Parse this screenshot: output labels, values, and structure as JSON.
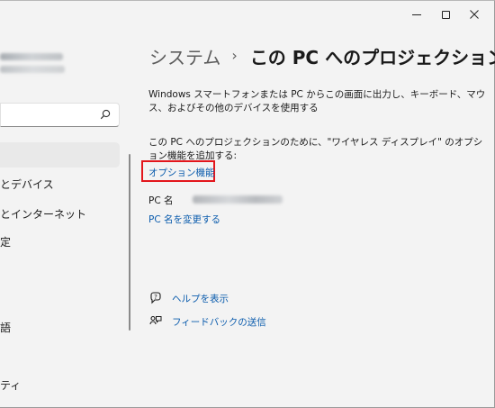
{
  "window": {
    "controls": {
      "minimize_icon": "minimize-icon",
      "maximize_icon": "maximize-icon",
      "close_icon": "close-icon"
    }
  },
  "sidebar": {
    "search": {
      "icon": "search-icon"
    },
    "items": [
      {
        "label": ""
      },
      {
        "label": "とデバイス"
      },
      {
        "label": "とインターネット"
      },
      {
        "label": "定"
      },
      {
        "label": "語"
      },
      {
        "label": "ティ"
      }
    ]
  },
  "main": {
    "breadcrumb": {
      "parent": "システム",
      "separator": "›",
      "current": "この PC へのプロジェクション"
    },
    "description": "Windows スマートフォンまたは PC からこの画面に出力し、キーボード、マウス、およびその他のデバイスを使用する",
    "option_prompt": "この PC へのプロジェクションのために、\"ワイヤレス ディスプレイ\" のオプション機能を追加する:",
    "option_link": "オプション機能",
    "pc_name_label": "PC 名",
    "rename_link": "PC 名を変更する",
    "help_links": [
      {
        "label": "ヘルプを表示",
        "icon": "help-icon"
      },
      {
        "label": "フィードバックの送信",
        "icon": "feedback-icon"
      }
    ]
  },
  "colors": {
    "link": "#0b5cad",
    "highlight_box": "#e3161c",
    "background": "#f3f3f3"
  }
}
